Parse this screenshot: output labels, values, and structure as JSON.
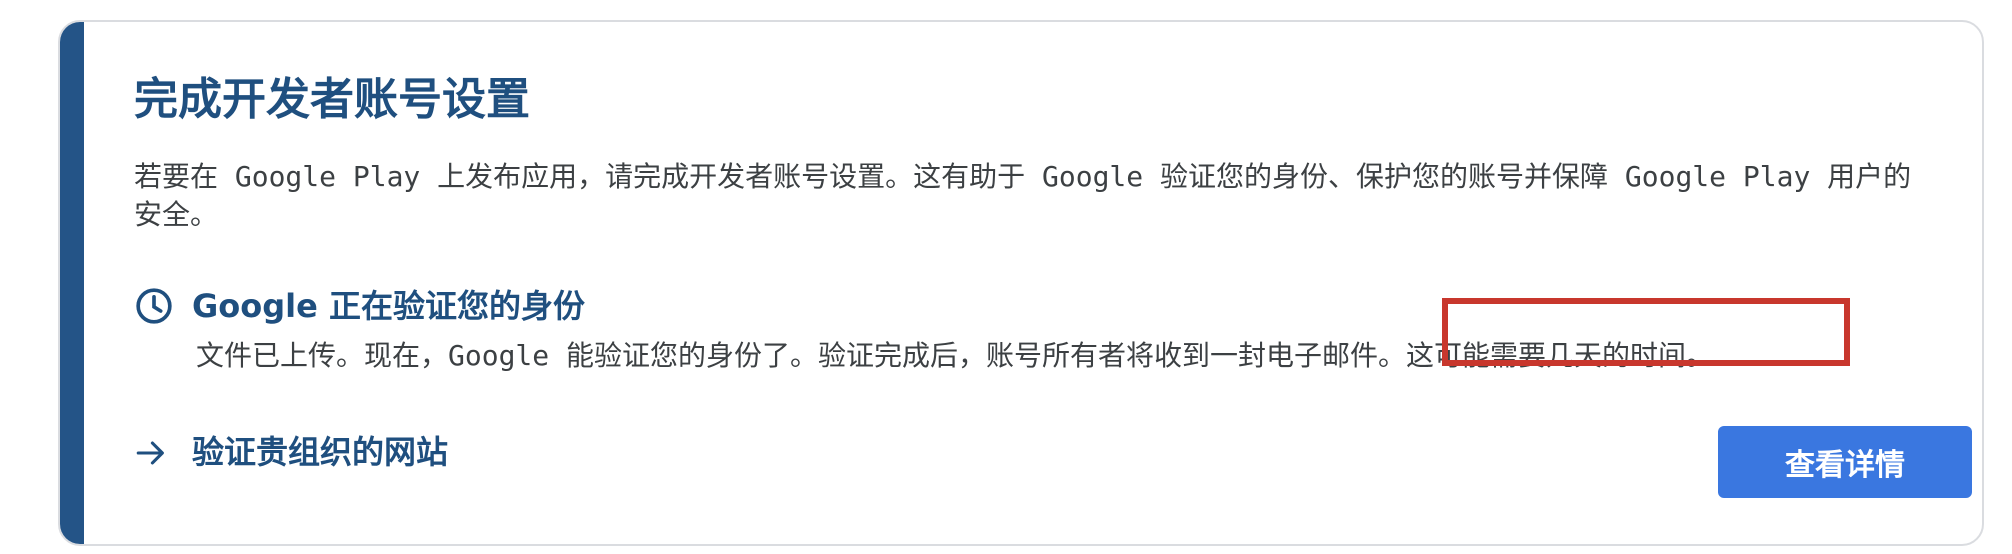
{
  "colors": {
    "accent": "#245487",
    "title": "#1f4f7f",
    "highlight": "#c8372d",
    "button_bg": "#3a77e0",
    "button_text": "#ffffff"
  },
  "card": {
    "title": "完成开发者账号设置",
    "description": "若要在 Google Play 上发布应用，请完成开发者账号设置。这有助于 Google 验证您的身份、保护您的账号并保障 Google Play 用户的安全。",
    "status": {
      "icon": "clock-icon",
      "title": "Google 正在验证您的身份",
      "text_main": "文件已上传。现在，Google 能验证您的身份了。验证完成后，账号所有者将收到一封电子邮件。",
      "text_highlight": "这可能需要几天的时间。"
    },
    "link": {
      "icon": "arrow-right-icon",
      "label": "验证贵组织的网站"
    },
    "button": {
      "label": "查看详情"
    }
  }
}
